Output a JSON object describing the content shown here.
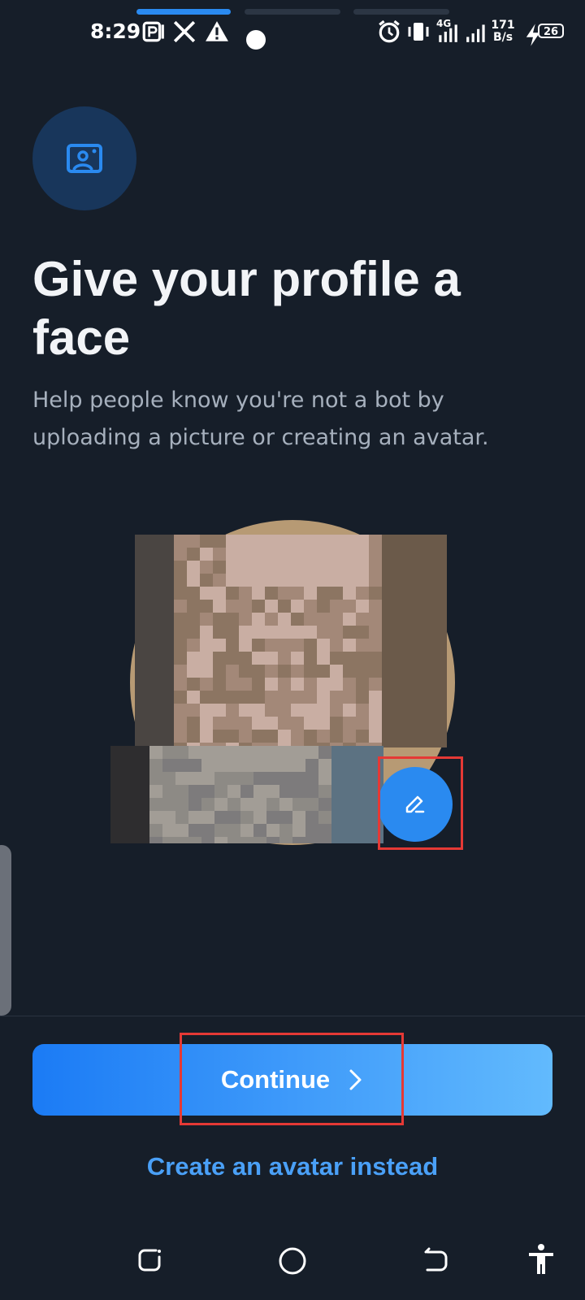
{
  "status_bar": {
    "time": "8:29",
    "net_speed_value": "171",
    "net_speed_unit": "B/s",
    "network_label": "4G",
    "battery": "26",
    "story_progress_segments": 3,
    "active_segment": 1
  },
  "header": {
    "icon": "profile-photo-icon",
    "title": "Give your profile a face",
    "subtitle": "Help people know you're not a bot by uploading a picture or creating an avatar."
  },
  "avatar": {
    "edit_icon": "pencil-icon"
  },
  "actions": {
    "continue_label": "Continue",
    "continue_icon": "chevron-right-icon",
    "alt_link": "Create an avatar instead"
  },
  "nav_bar": {
    "icons": [
      "recents-icon",
      "home-icon",
      "back-icon",
      "accessibility-icon"
    ]
  },
  "colors": {
    "background": "#161e29",
    "accent": "#2a8af0",
    "link": "#4aa0f7",
    "highlight": "#e53935"
  }
}
